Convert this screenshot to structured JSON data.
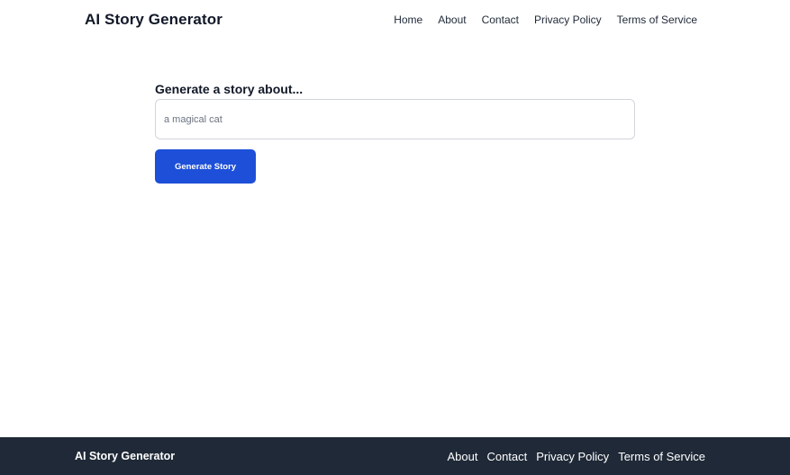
{
  "header": {
    "brand": "AI Story Generator",
    "nav": [
      "Home",
      "About",
      "Contact",
      "Privacy Policy",
      "Terms of Service"
    ]
  },
  "form": {
    "label": "Generate a story about...",
    "input_value": "",
    "input_placeholder": "a magical cat",
    "button_label": "Generate Story"
  },
  "footer": {
    "brand": "AI Story Generator",
    "nav": [
      "About",
      "Contact",
      "Privacy Policy",
      "Terms of Service"
    ]
  },
  "colors": {
    "primary_button": "#1d4fd8",
    "footer_background": "#1f2937",
    "page_background": "#ffffff"
  }
}
